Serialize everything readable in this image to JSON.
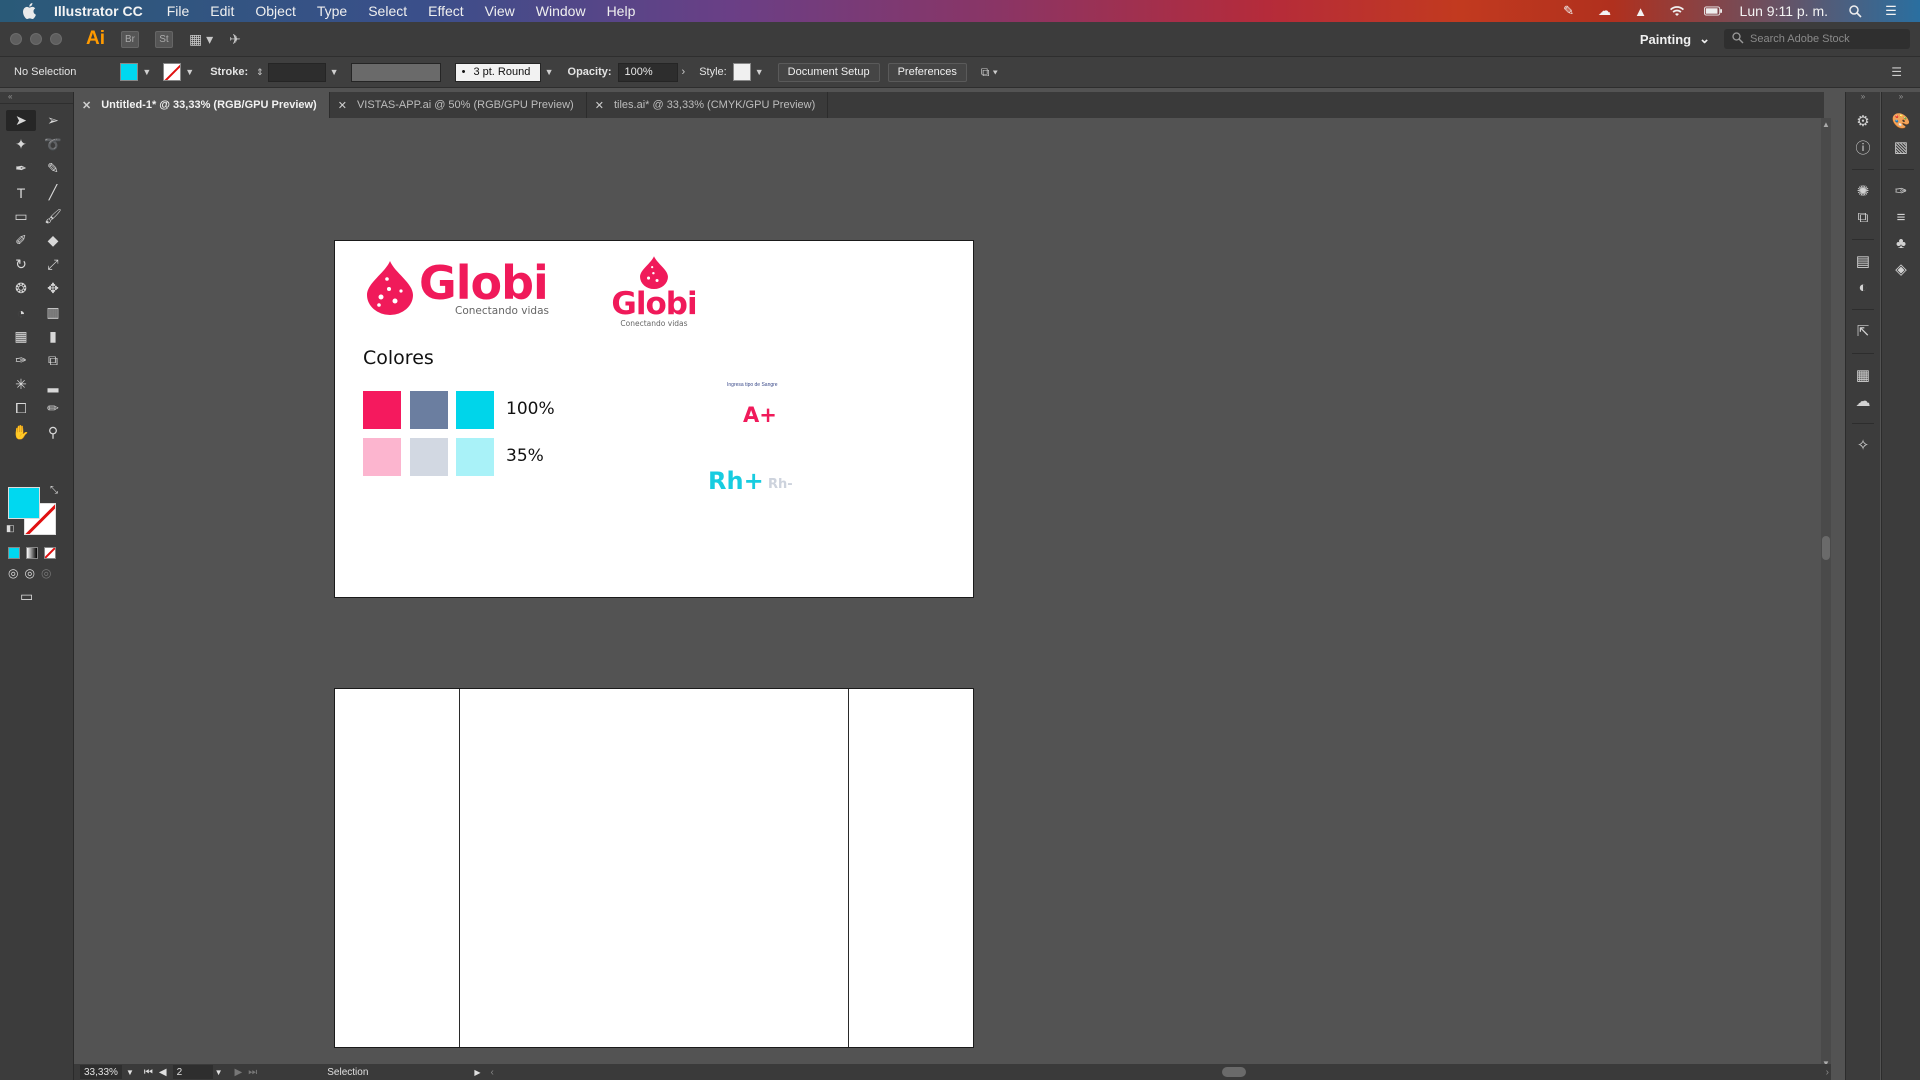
{
  "menubar": {
    "app_name": "Illustrator CC",
    "items": [
      "File",
      "Edit",
      "Object",
      "Type",
      "Select",
      "Effect",
      "View",
      "Window",
      "Help"
    ],
    "clock": "Lun 9:11 p. m."
  },
  "appbar": {
    "logo": "Ai",
    "bridge": "Br",
    "stock": "St",
    "workspace": "Painting",
    "search_placeholder": "Search Adobe Stock"
  },
  "control": {
    "selection_status": "No Selection",
    "stroke_label": "Stroke:",
    "brush_value": "3 pt. Round",
    "brush_dot": "•",
    "opacity_label": "Opacity:",
    "opacity_value": "100%",
    "style_label": "Style:",
    "document_setup": "Document Setup",
    "preferences": "Preferences"
  },
  "tabs": [
    {
      "label": "Untitled-1* @ 33,33% (RGB/GPU Preview)",
      "active": true
    },
    {
      "label": "VISTAS-APP.ai @ 50% (RGB/GPU Preview)",
      "active": false
    },
    {
      "label": "tiles.ai* @ 33,33% (CMYK/GPU Preview)",
      "active": false
    }
  ],
  "artboard1": {
    "logo_word": "Globi",
    "logo_tagline": "Conectando vidas",
    "logo2_word": "Globi",
    "logo2_tagline": "Conectando vidas",
    "colors_title": "Colores",
    "pct_100": "100%",
    "pct_35": "35%",
    "blood_label": "Ingresa tipo de Sangre",
    "blood_type": "A+",
    "rh_positive": "Rh+",
    "rh_negative": "Rh-"
  },
  "palette": {
    "full": [
      "#f5195e",
      "#6b7ea0",
      "#00d5ea"
    ],
    "light": [
      "#fcb5cf",
      "#d2d8e2",
      "#a9f2f8"
    ]
  },
  "fill_color": "#00d8f0",
  "status": {
    "zoom": "33,33%",
    "artboard_num": "2",
    "tool_name": "Selection"
  },
  "tools_left": [
    "selection-tool-icon",
    "magic-wand-icon",
    "pen-tool-icon",
    "type-tool-icon",
    "rectangle-tool-icon",
    "shaper-tool-icon",
    "rotate-tool-icon",
    "warp-tool-icon",
    "shape-builder-icon",
    "mesh-tool-icon",
    "eyedropper-icon",
    "symbol-sprayer-icon",
    "artboard-tool-icon",
    "hand-tool-icon"
  ],
  "tools_right": [
    "direct-selection-icon",
    "lasso-icon",
    "curvature-tool-icon",
    "line-tool-icon",
    "paintbrush-icon",
    "eraser-icon",
    "scale-tool-icon",
    "puppet-warp-icon",
    "perspective-grid-icon",
    "gradient-tool-icon",
    "blend-tool-icon",
    "column-graph-icon",
    "slice-tool-icon",
    "zoom-tool-icon"
  ]
}
